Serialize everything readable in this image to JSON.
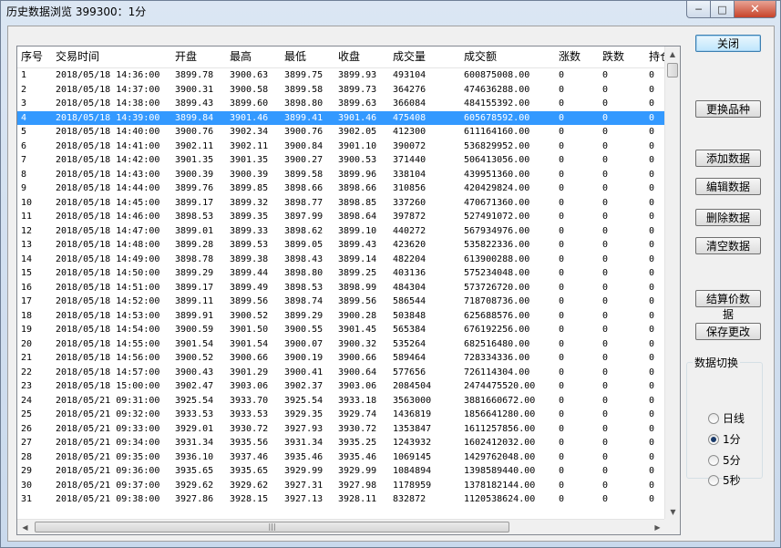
{
  "window": {
    "title": "历史数据浏览 399300：1分",
    "min_glyph": "─",
    "max_glyph": "□",
    "close_glyph": "✕"
  },
  "table": {
    "columns": [
      "序号",
      "交易时间",
      "开盘",
      "最高",
      "最低",
      "收盘",
      "成交量",
      "成交额",
      "涨数",
      "跌数",
      "持仓"
    ],
    "selected_index": 3,
    "rows": [
      [
        "1",
        "2018/05/18 14:36:00",
        "3899.78",
        "3900.63",
        "3899.75",
        "3899.93",
        "493104",
        "600875008.00",
        "0",
        "0",
        "0"
      ],
      [
        "2",
        "2018/05/18 14:37:00",
        "3900.31",
        "3900.58",
        "3899.58",
        "3899.73",
        "364276",
        "474636288.00",
        "0",
        "0",
        "0"
      ],
      [
        "3",
        "2018/05/18 14:38:00",
        "3899.43",
        "3899.60",
        "3898.80",
        "3899.63",
        "366084",
        "484155392.00",
        "0",
        "0",
        "0"
      ],
      [
        "4",
        "2018/05/18 14:39:00",
        "3899.84",
        "3901.46",
        "3899.41",
        "3901.46",
        "475408",
        "605678592.00",
        "0",
        "0",
        "0"
      ],
      [
        "5",
        "2018/05/18 14:40:00",
        "3900.76",
        "3902.34",
        "3900.76",
        "3902.05",
        "412300",
        "611164160.00",
        "0",
        "0",
        "0"
      ],
      [
        "6",
        "2018/05/18 14:41:00",
        "3902.11",
        "3902.11",
        "3900.84",
        "3901.10",
        "390072",
        "536829952.00",
        "0",
        "0",
        "0"
      ],
      [
        "7",
        "2018/05/18 14:42:00",
        "3901.35",
        "3901.35",
        "3900.27",
        "3900.53",
        "371440",
        "506413056.00",
        "0",
        "0",
        "0"
      ],
      [
        "8",
        "2018/05/18 14:43:00",
        "3900.39",
        "3900.39",
        "3899.58",
        "3899.96",
        "338104",
        "439951360.00",
        "0",
        "0",
        "0"
      ],
      [
        "9",
        "2018/05/18 14:44:00",
        "3899.76",
        "3899.85",
        "3898.66",
        "3898.66",
        "310856",
        "420429824.00",
        "0",
        "0",
        "0"
      ],
      [
        "10",
        "2018/05/18 14:45:00",
        "3899.17",
        "3899.32",
        "3898.77",
        "3898.85",
        "337260",
        "470671360.00",
        "0",
        "0",
        "0"
      ],
      [
        "11",
        "2018/05/18 14:46:00",
        "3898.53",
        "3899.35",
        "3897.99",
        "3898.64",
        "397872",
        "527491072.00",
        "0",
        "0",
        "0"
      ],
      [
        "12",
        "2018/05/18 14:47:00",
        "3899.01",
        "3899.33",
        "3898.62",
        "3899.10",
        "440272",
        "567934976.00",
        "0",
        "0",
        "0"
      ],
      [
        "13",
        "2018/05/18 14:48:00",
        "3899.28",
        "3899.53",
        "3899.05",
        "3899.43",
        "423620",
        "535822336.00",
        "0",
        "0",
        "0"
      ],
      [
        "14",
        "2018/05/18 14:49:00",
        "3898.78",
        "3899.38",
        "3898.43",
        "3899.14",
        "482204",
        "613900288.00",
        "0",
        "0",
        "0"
      ],
      [
        "15",
        "2018/05/18 14:50:00",
        "3899.29",
        "3899.44",
        "3898.80",
        "3899.25",
        "403136",
        "575234048.00",
        "0",
        "0",
        "0"
      ],
      [
        "16",
        "2018/05/18 14:51:00",
        "3899.17",
        "3899.49",
        "3898.53",
        "3898.99",
        "484304",
        "573726720.00",
        "0",
        "0",
        "0"
      ],
      [
        "17",
        "2018/05/18 14:52:00",
        "3899.11",
        "3899.56",
        "3898.74",
        "3899.56",
        "586544",
        "718708736.00",
        "0",
        "0",
        "0"
      ],
      [
        "18",
        "2018/05/18 14:53:00",
        "3899.91",
        "3900.52",
        "3899.29",
        "3900.28",
        "503848",
        "625688576.00",
        "0",
        "0",
        "0"
      ],
      [
        "19",
        "2018/05/18 14:54:00",
        "3900.59",
        "3901.50",
        "3900.55",
        "3901.45",
        "565384",
        "676192256.00",
        "0",
        "0",
        "0"
      ],
      [
        "20",
        "2018/05/18 14:55:00",
        "3901.54",
        "3901.54",
        "3900.07",
        "3900.32",
        "535264",
        "682516480.00",
        "0",
        "0",
        "0"
      ],
      [
        "21",
        "2018/05/18 14:56:00",
        "3900.52",
        "3900.66",
        "3900.19",
        "3900.66",
        "589464",
        "728334336.00",
        "0",
        "0",
        "0"
      ],
      [
        "22",
        "2018/05/18 14:57:00",
        "3900.43",
        "3901.29",
        "3900.41",
        "3900.64",
        "577656",
        "726114304.00",
        "0",
        "0",
        "0"
      ],
      [
        "23",
        "2018/05/18 15:00:00",
        "3902.47",
        "3903.06",
        "3902.37",
        "3903.06",
        "2084504",
        "2474475520.00",
        "0",
        "0",
        "0"
      ],
      [
        "24",
        "2018/05/21 09:31:00",
        "3925.54",
        "3933.70",
        "3925.54",
        "3933.18",
        "3563000",
        "3881660672.00",
        "0",
        "0",
        "0"
      ],
      [
        "25",
        "2018/05/21 09:32:00",
        "3933.53",
        "3933.53",
        "3929.35",
        "3929.74",
        "1436819",
        "1856641280.00",
        "0",
        "0",
        "0"
      ],
      [
        "26",
        "2018/05/21 09:33:00",
        "3929.01",
        "3930.72",
        "3927.93",
        "3930.72",
        "1353847",
        "1611257856.00",
        "0",
        "0",
        "0"
      ],
      [
        "27",
        "2018/05/21 09:34:00",
        "3931.34",
        "3935.56",
        "3931.34",
        "3935.25",
        "1243932",
        "1602412032.00",
        "0",
        "0",
        "0"
      ],
      [
        "28",
        "2018/05/21 09:35:00",
        "3936.10",
        "3937.46",
        "3935.46",
        "3935.46",
        "1069145",
        "1429762048.00",
        "0",
        "0",
        "0"
      ],
      [
        "29",
        "2018/05/21 09:36:00",
        "3935.65",
        "3935.65",
        "3929.99",
        "3929.99",
        "1084894",
        "1398589440.00",
        "0",
        "0",
        "0"
      ],
      [
        "30",
        "2018/05/21 09:37:00",
        "3929.62",
        "3929.62",
        "3927.31",
        "3927.98",
        "1178959",
        "1378182144.00",
        "0",
        "0",
        "0"
      ],
      [
        "31",
        "2018/05/21 09:38:00",
        "3927.86",
        "3928.15",
        "3927.13",
        "3928.11",
        "832872",
        "1120538624.00",
        "0",
        "0",
        "0"
      ]
    ]
  },
  "buttons": {
    "close": "关闭",
    "change_product": "更换品种",
    "add_data": "添加数据",
    "edit_data": "编辑数据",
    "delete_data": "删除数据",
    "clear_data": "清空数据",
    "settlement_data": "结算价数据",
    "save_changes": "保存更改"
  },
  "data_switch": {
    "label": "数据切换",
    "options": [
      "日线",
      "1分",
      "5分",
      "5秒"
    ],
    "selected": "1分"
  },
  "scroll": {
    "up": "▲",
    "down": "▼",
    "left": "◀",
    "right": "▶",
    "grip": "|||"
  }
}
